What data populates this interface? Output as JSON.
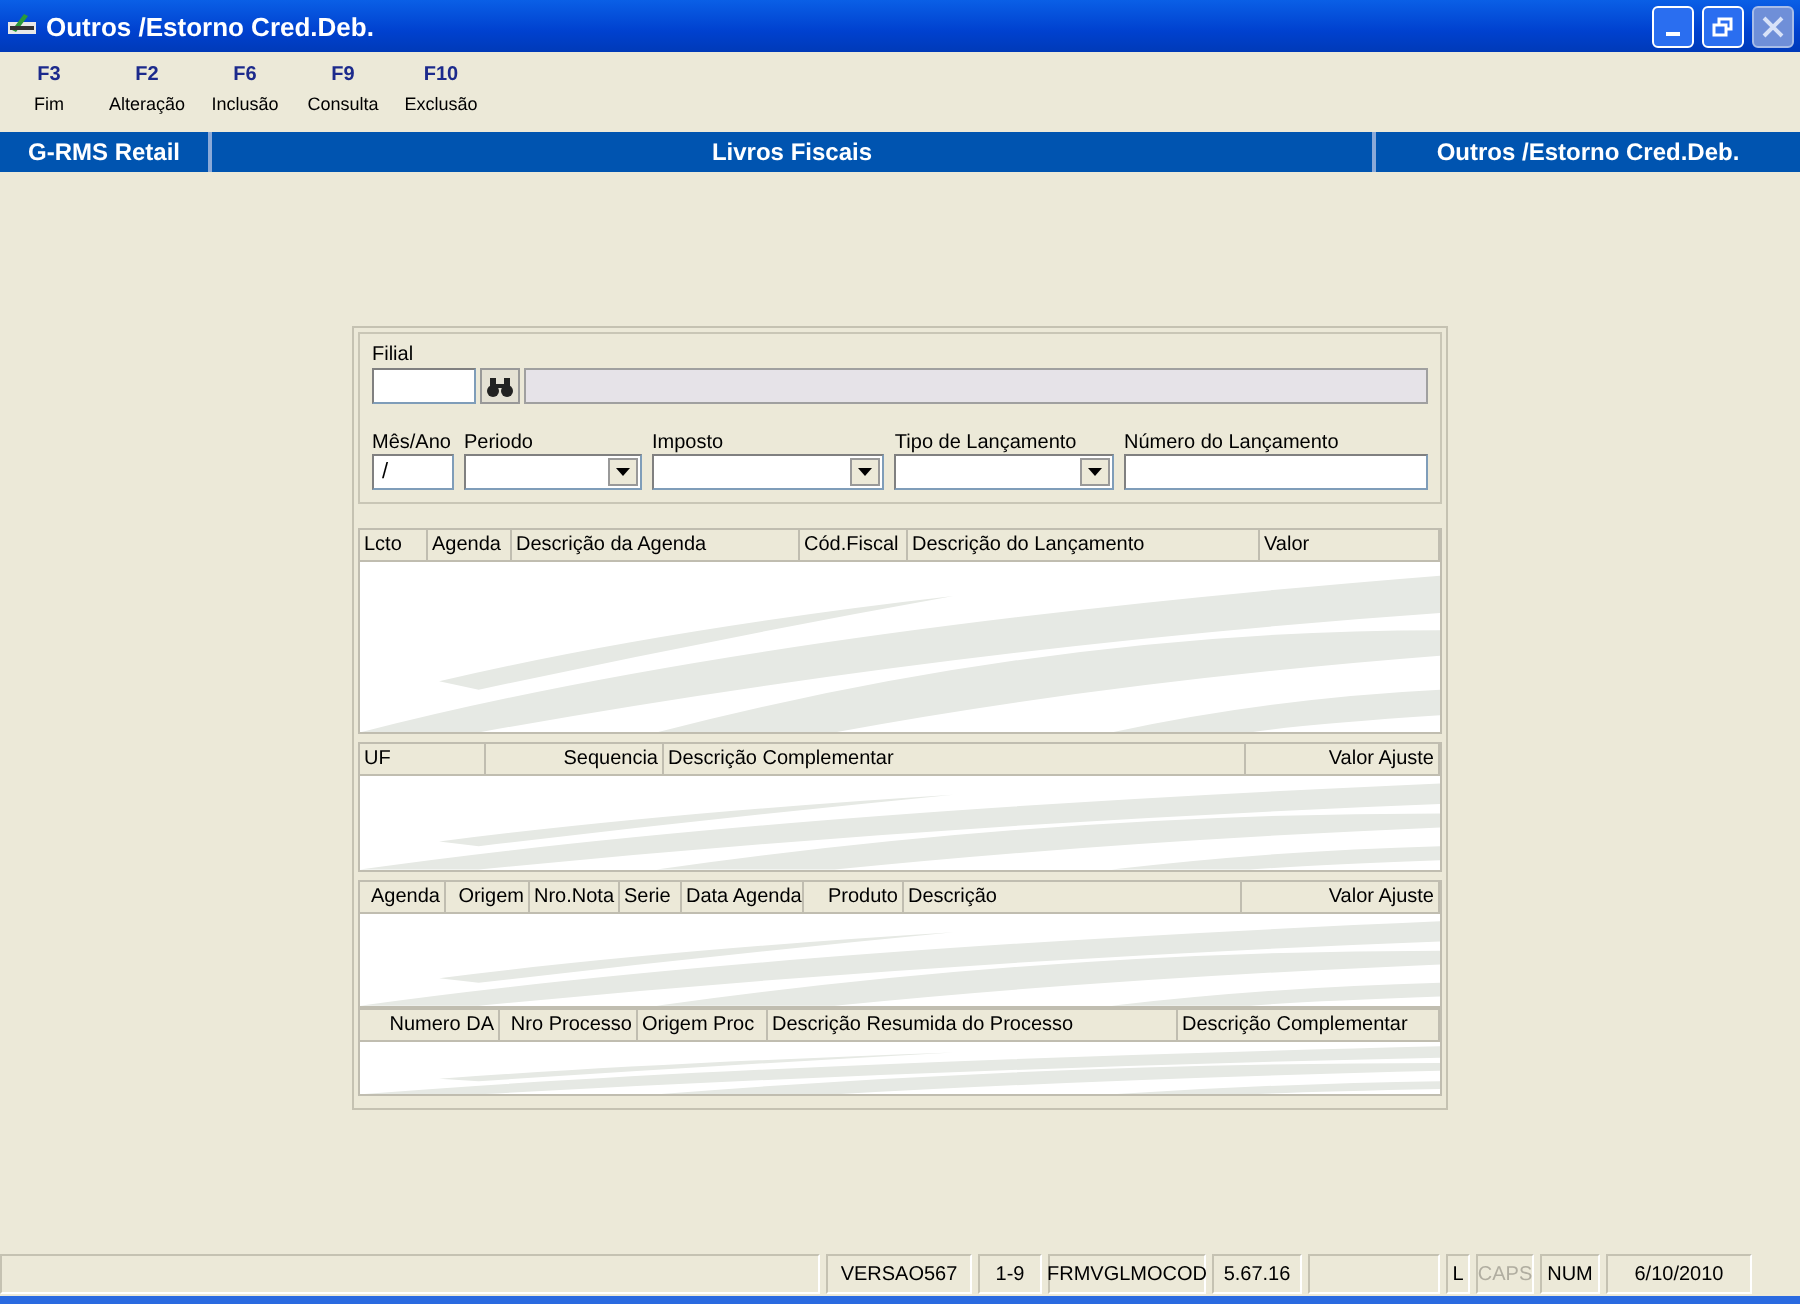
{
  "window": {
    "title": "Outros /Estorno Cred.Deb."
  },
  "toolbar": [
    {
      "key": "F3",
      "label": "Fim"
    },
    {
      "key": "F2",
      "label": "Alteração"
    },
    {
      "key": "F6",
      "label": "Inclusão"
    },
    {
      "key": "F9",
      "label": "Consulta"
    },
    {
      "key": "F10",
      "label": "Exclusão"
    }
  ],
  "header": [
    "G-RMS Retail",
    "Livros Fiscais",
    "Outros /Estorno Cred.Deb."
  ],
  "form": {
    "filial_label": "Filial",
    "row": [
      {
        "kind": "text",
        "label": "Mês/Ano",
        "value": "/"
      },
      {
        "kind": "combo",
        "label": "Periodo"
      },
      {
        "kind": "combo",
        "label": "Imposto"
      },
      {
        "kind": "combo",
        "label": "Tipo de Lançamento"
      },
      {
        "kind": "text",
        "label": "Número do Lançamento"
      }
    ]
  },
  "grids": [
    {
      "columns": [
        {
          "label": "Lcto",
          "kind": "text"
        },
        {
          "label": "Agenda",
          "kind": "text"
        },
        {
          "label": "Descrição da Agenda",
          "kind": "text"
        },
        {
          "label": "Cód.Fiscal",
          "kind": "text"
        },
        {
          "label": "Descrição do Lançamento",
          "kind": "text"
        },
        {
          "label": "Valor",
          "kind": "text"
        }
      ]
    },
    {
      "columns": [
        {
          "label": "UF",
          "kind": "text"
        },
        {
          "label": "Sequencia",
          "kind": "numeric"
        },
        {
          "label": "Descrição Complementar",
          "kind": "text"
        },
        {
          "label": "Valor Ajuste",
          "kind": "numeric"
        }
      ]
    },
    {
      "columns": [
        {
          "label": "Agenda",
          "kind": "numeric"
        },
        {
          "label": "Origem",
          "kind": "numeric"
        },
        {
          "label": "Nro.Nota",
          "kind": "numeric"
        },
        {
          "label": "Serie",
          "kind": "text"
        },
        {
          "label": "Data Agenda",
          "kind": "text"
        },
        {
          "label": "Produto",
          "kind": "numeric"
        },
        {
          "label": "Descrição",
          "kind": "text"
        },
        {
          "label": "Valor Ajuste",
          "kind": "numeric"
        }
      ]
    },
    {
      "columns": [
        {
          "label": "Numero DA",
          "kind": "numeric"
        },
        {
          "label": "Nro Processo",
          "kind": "numeric"
        },
        {
          "label": "Origem Proc",
          "kind": "text"
        },
        {
          "label": "Descrição Resumida do Processo",
          "kind": "text"
        },
        {
          "label": "Descrição Complementar",
          "kind": "text"
        }
      ]
    }
  ],
  "status_bar": [
    {
      "kind": "blank"
    },
    {
      "kind": "text",
      "text": "VERSAO567",
      "disabled": false
    },
    {
      "kind": "text",
      "text": "1-9",
      "disabled": false
    },
    {
      "kind": "text",
      "text": "FRMVGLMOCOD",
      "disabled": false
    },
    {
      "kind": "text",
      "text": "5.67.16",
      "disabled": false
    },
    {
      "kind": "blank"
    },
    {
      "kind": "text",
      "text": "L",
      "disabled": false
    },
    {
      "kind": "text",
      "text": "CAPS",
      "disabled": true
    },
    {
      "kind": "text",
      "text": "NUM",
      "disabled": false
    },
    {
      "kind": "text",
      "text": "6/10/2010",
      "disabled": false
    }
  ]
}
